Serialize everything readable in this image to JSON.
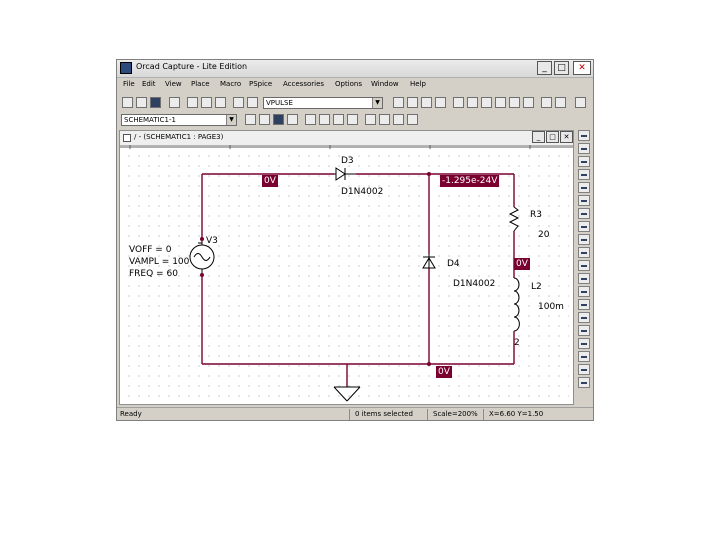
{
  "window": {
    "title": "Orcad Capture - Lite Edition"
  },
  "menu": [
    "File",
    "Edit",
    "View",
    "Place",
    "Macro",
    "PSpice",
    "Accessories",
    "Options",
    "Window",
    "Help"
  ],
  "toolbar": {
    "part_combo_value": "VPULSE",
    "schematic_combo_value": "SCHEMATIC1-1"
  },
  "document": {
    "title": "/ - (SCHEMATIC1 : PAGE3)"
  },
  "schematic": {
    "diode_d3": {
      "ref": "D3",
      "part": "D1N4002"
    },
    "diode_d4": {
      "ref": "D4",
      "part": "D1N4002"
    },
    "source_v3": {
      "ref": "V3",
      "voff": "VOFF = 0",
      "vampl": "VAMPL = 100",
      "freq": "FREQ = 60"
    },
    "resistor_r3": {
      "ref": "R3",
      "value": "20"
    },
    "inductor_l2": {
      "ref": "L2",
      "value": "100m",
      "pin": "2"
    },
    "voltage_markers": {
      "left": "0V",
      "right": "-1.295e-24V",
      "mid": "0V",
      "bottom": "0V"
    }
  },
  "status": {
    "ready": "Ready",
    "selected": "0 items selected",
    "scale": "Scale=200%",
    "coords": "X=6.60  Y=1.50"
  },
  "colors": {
    "wire": "#7a0030",
    "label_bg": "#7a0030",
    "window_bg": "#d4d0c8"
  }
}
